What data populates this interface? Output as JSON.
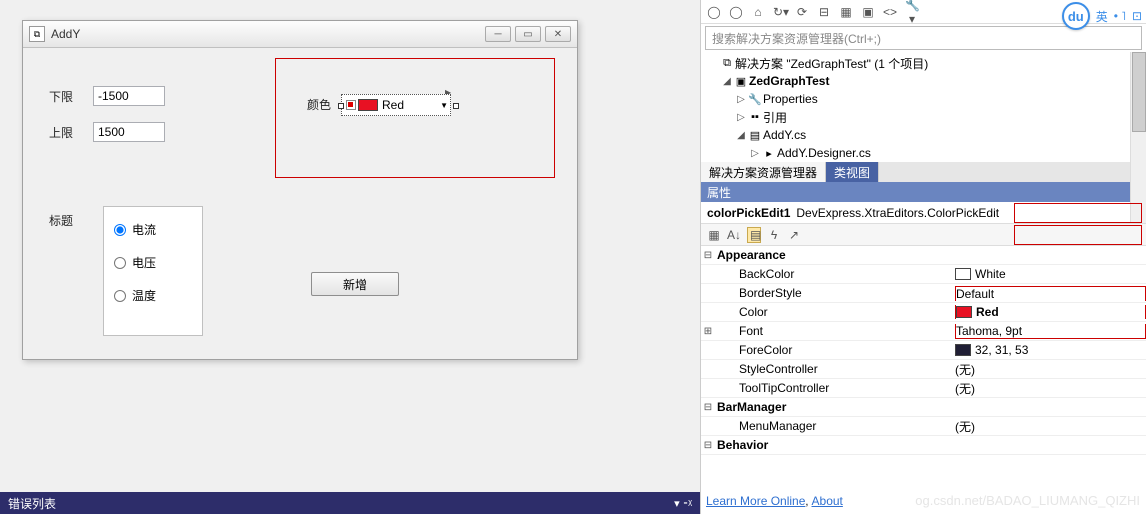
{
  "form": {
    "title": "AddY",
    "lower_label": "下限",
    "lower_value": "-1500",
    "upper_label": "上限",
    "upper_value": "1500",
    "color_label": "颜色",
    "color_value": "Red",
    "title_label": "标题",
    "radios": {
      "current": "电流",
      "voltage": "电压",
      "temperature": "温度"
    },
    "add_button": "新增"
  },
  "error_list_title": "错误列表",
  "solution_explorer": {
    "search_placeholder": "搜索解决方案资源管理器(Ctrl+;)",
    "root": "解决方案 \"ZedGraphTest\" (1 个项目)",
    "project": "ZedGraphTest",
    "nodes": {
      "properties": "Properties",
      "references": "引用",
      "addy_cs": "AddY.cs",
      "addy_designer": "AddY.Designer.cs"
    },
    "tabs": {
      "sol": "解决方案资源管理器",
      "class": "类视图"
    }
  },
  "properties": {
    "panel_title": "属性",
    "object_name": "colorPickEdit1",
    "object_type": "DevExpress.XtraEditors.ColorPickEdit",
    "categories": {
      "appearance": "Appearance",
      "barmanager": "BarManager",
      "behavior": "Behavior"
    },
    "rows": {
      "backcolor_n": "BackColor",
      "backcolor_v": "White",
      "borderstyle_n": "BorderStyle",
      "borderstyle_v": "Default",
      "color_n": "Color",
      "color_v": "Red",
      "font_n": "Font",
      "font_v": "Tahoma, 9pt",
      "forecolor_n": "ForeColor",
      "forecolor_v": "32, 31, 53",
      "stylecontroller_n": "StyleController",
      "stylecontroller_v": "(无)",
      "tooltipcontroller_n": "ToolTipController",
      "tooltipcontroller_v": "(无)",
      "menumanager_n": "MenuManager",
      "menumanager_v": "(无)"
    }
  },
  "links": {
    "learn": "Learn More Online",
    "about": "About"
  },
  "watermark": "og.csdn.net/BADAO_LIUMANG_QIZHI",
  "badge": {
    "du": "du",
    "lang": "英"
  }
}
